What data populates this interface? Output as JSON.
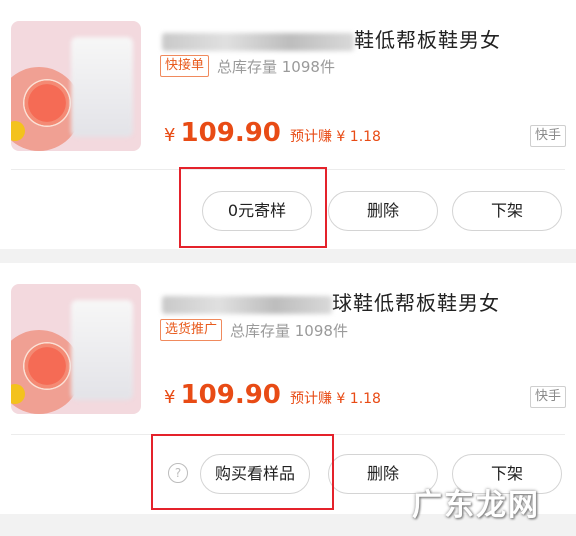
{
  "products": [
    {
      "title_visible": "鞋低帮板鞋男女",
      "tag": "快接单",
      "stock": "总库存量 1098件",
      "currency": "¥",
      "price": "109.90",
      "estimate": "预计赚 ¥ 1.18",
      "platform": "快手",
      "buttons": {
        "sample": "0元寄样",
        "delete": "删除",
        "off_shelf": "下架"
      }
    },
    {
      "title_visible": "球鞋低帮板鞋男女",
      "tag": "选货推广",
      "stock": "总库存量 1098件",
      "currency": "¥",
      "price": "109.90",
      "estimate": "预计赚 ¥ 1.18",
      "platform": "快手",
      "buttons": {
        "sample": "购买看样品",
        "delete": "删除",
        "off_shelf": "下架"
      },
      "help_icon": "?"
    }
  ],
  "watermark": "广东龙网",
  "colors": {
    "accent": "#e84b15",
    "highlight": "#e4222b"
  }
}
